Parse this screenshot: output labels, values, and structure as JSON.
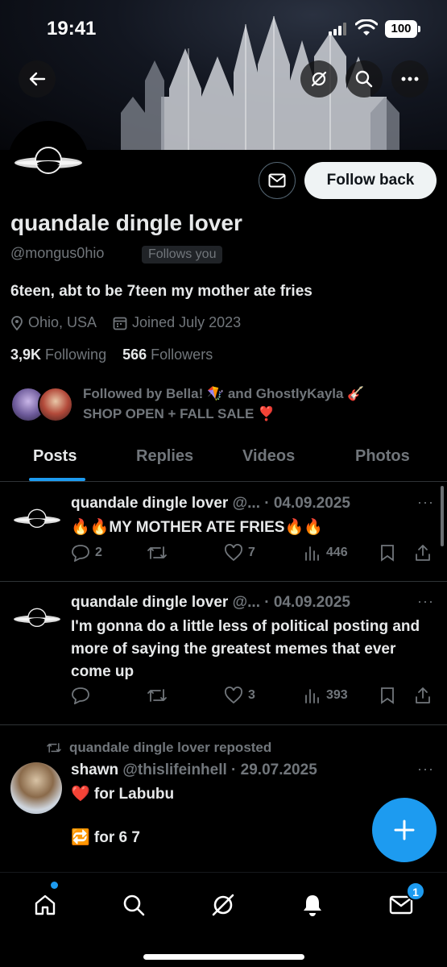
{
  "status_bar": {
    "time": "19:41",
    "battery": "100"
  },
  "header": {
    "back_icon": "arrow-left-icon",
    "grok_icon": "grok-icon",
    "search_icon": "search-icon",
    "more_icon": "more-horizontal-icon"
  },
  "profile": {
    "name": "quandale dingle lover",
    "handle": "@mongus0hio",
    "follows_you": "Follows you",
    "bio": "6teen, abt to be 7teen my mother ate fries",
    "location": "Ohio, USA",
    "joined": "Joined July 2023",
    "following_count": "3,9K",
    "following_label": "Following",
    "followers_count": "566",
    "followers_label": "Followers",
    "follow_back_label": "Follow back",
    "followed_by_line1": "Followed by Bella! 🪁 and GhostlyKayla 🎸",
    "followed_by_line2": "SHOP OPEN + FALL SALE ❣️"
  },
  "tabs": [
    {
      "label": "Posts",
      "active": true
    },
    {
      "label": "Replies",
      "active": false
    },
    {
      "label": "Videos",
      "active": false
    },
    {
      "label": "Photos",
      "active": false
    }
  ],
  "posts": [
    {
      "author": "quandale dingle lover",
      "handle_date": "@... · 04.09.2025",
      "text": "🔥🔥MY MOTHER ATE FRIES🔥🔥",
      "replies": "2",
      "reposts": "",
      "likes": "7",
      "views": "446"
    },
    {
      "author": "quandale dingle lover",
      "handle_date": "@... · 04.09.2025",
      "text": "I'm gonna do a little less of political posting and more of saying the greatest memes that ever come up",
      "replies": "",
      "reposts": "",
      "likes": "3",
      "views": "393"
    },
    {
      "repost_label": "quandale dingle lover reposted",
      "author": "shawn",
      "handle_date": "@thislifeinhell · 29.07.2025",
      "line1": "❤️ for Labubu",
      "line2": "🔁 for 6 7"
    }
  ],
  "more_dots": "···",
  "fab_icon": "plus-icon",
  "bottom_nav": {
    "home_icon": "home-icon",
    "search_icon": "search-icon",
    "grok_icon": "grok-icon",
    "notifications_icon": "bell-icon",
    "messages_icon": "mail-icon",
    "messages_badge": "1"
  },
  "colors": {
    "accent": "#1d9bf0",
    "text": "#e7e9ea",
    "muted": "#71767b"
  }
}
